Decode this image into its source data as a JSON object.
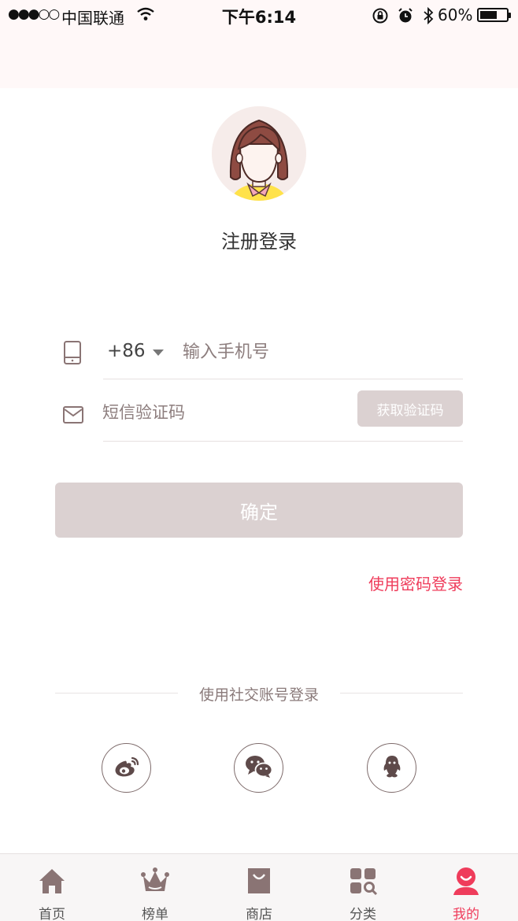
{
  "status_bar": {
    "signal": "●●●○○",
    "carrier": "中国联通",
    "time": "下午6:14",
    "battery_percent": "60%"
  },
  "login": {
    "title": "注册登录",
    "country_code": "+86",
    "phone_placeholder": "输入手机号",
    "sms_placeholder": "短信验证码",
    "get_code_label": "获取验证码",
    "confirm_label": "确定",
    "password_login_label": "使用密码登录",
    "social_title": "使用社交账号登录",
    "social_icons": [
      "weibo-icon",
      "wechat-icon",
      "qq-icon"
    ]
  },
  "tab_bar": {
    "items": [
      {
        "label": "首页",
        "icon": "home-icon"
      },
      {
        "label": "榜单",
        "icon": "crown-icon"
      },
      {
        "label": "商店",
        "icon": "shopping-bag-icon"
      },
      {
        "label": "分类",
        "icon": "category-icon"
      },
      {
        "label": "我的",
        "icon": "profile-icon"
      }
    ],
    "active_index": 4
  },
  "colors": {
    "accent": "#ef3c5b",
    "button_disabled": "#dbd1d1",
    "icon_brown": "#8a7474",
    "header_tint": "#fff8f8"
  }
}
